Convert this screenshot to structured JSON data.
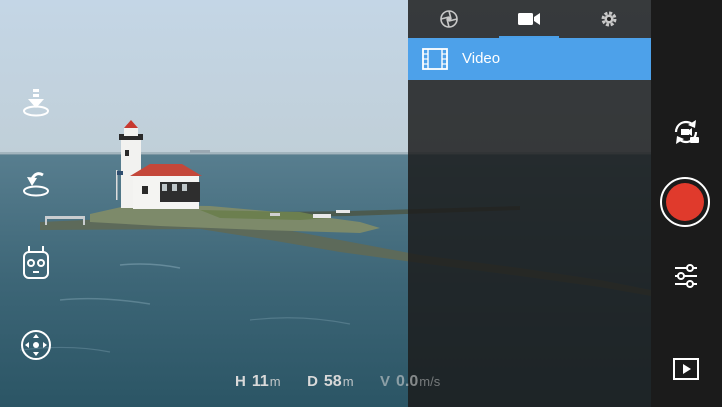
{
  "camera_mode_tabs": [
    {
      "name": "photo",
      "icon": "aperture-icon",
      "active": false
    },
    {
      "name": "video",
      "icon": "video-camera-icon",
      "active": true
    },
    {
      "name": "settings",
      "icon": "gear-icon",
      "active": false
    }
  ],
  "mode_list": [
    {
      "label": "Video",
      "icon": "film-strip-icon",
      "selected": true
    }
  ],
  "left_controls": [
    "takeoff-icon",
    "return-home-icon",
    "remote-controller-icon",
    "joystick-icon"
  ],
  "right_controls": [
    "switch-camera-icon",
    "record-button",
    "sliders-icon",
    "playback-icon"
  ],
  "telemetry": {
    "height_label": "H",
    "height_value": "11",
    "height_unit": "m",
    "distance_label": "D",
    "distance_value": "58",
    "distance_unit": "m",
    "velocity_label": "V",
    "velocity_value": "0.0",
    "velocity_unit": "m/s"
  },
  "colors": {
    "accent": "#4da1ea",
    "record": "#e03a2c",
    "panel": "#1b1b1b"
  }
}
